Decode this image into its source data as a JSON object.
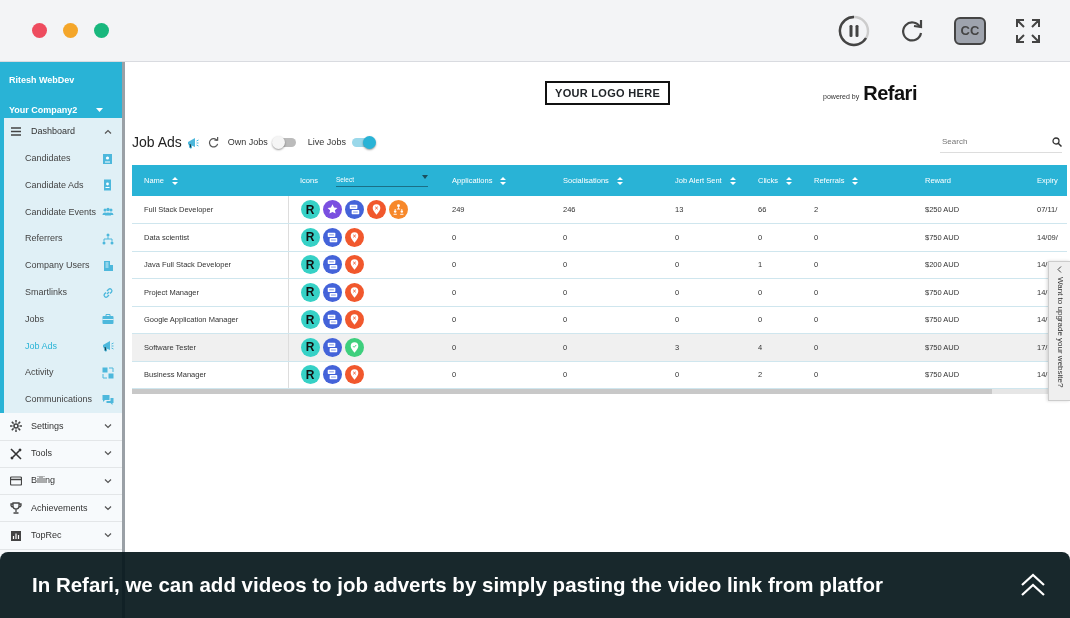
{
  "player": {
    "controls": [
      {
        "kind": "pause"
      },
      {
        "kind": "reload"
      },
      {
        "kind": "cc",
        "label": "CC",
        "on": true
      },
      {
        "kind": "fullscreen"
      }
    ]
  },
  "sidebar": {
    "user": "Ritesh WebDev",
    "company": "Your Company2",
    "sections": [
      {
        "label": "Dashboard",
        "expanded": true,
        "children": [
          {
            "label": "Candidates",
            "selected": false
          },
          {
            "label": "Candidate Ads",
            "selected": false
          },
          {
            "label": "Candidate Events",
            "selected": false
          },
          {
            "label": "Referrers",
            "selected": false
          },
          {
            "label": "Company Users",
            "selected": false
          },
          {
            "label": "Smartlinks",
            "selected": false
          },
          {
            "label": "Jobs",
            "selected": false
          },
          {
            "label": "Job Ads",
            "selected": true
          },
          {
            "label": "Activity",
            "selected": false
          },
          {
            "label": "Communications",
            "selected": false
          }
        ]
      },
      {
        "label": "Settings",
        "expanded": false
      },
      {
        "label": "Tools",
        "expanded": false
      },
      {
        "label": "Billing",
        "expanded": false
      },
      {
        "label": "Achievements",
        "expanded": false
      },
      {
        "label": "TopRec",
        "expanded": false
      }
    ]
  },
  "header": {
    "logo": "YOUR LOGO HERE",
    "powered_by": "powered by",
    "brand": "Refari"
  },
  "toolbar": {
    "title": "Job Ads",
    "toggles": [
      {
        "label": "Own Jobs",
        "on": false
      },
      {
        "label": "Live Jobs",
        "on": true
      }
    ],
    "search": {
      "placeholder": "Search"
    }
  },
  "table": {
    "columns": [
      {
        "label": "Name",
        "sortable": true
      },
      {
        "label": "Icons",
        "sortable": false,
        "filter": "Select"
      },
      {
        "label": "Applications",
        "sortable": true
      },
      {
        "label": "Socialisations",
        "sortable": true
      },
      {
        "label": "Job Alert Sent",
        "sortable": true
      },
      {
        "label": "Clicks",
        "sortable": true
      },
      {
        "label": "Referrals",
        "sortable": true
      },
      {
        "label": "Reward",
        "sortable": false
      },
      {
        "label": "Expiry"
      }
    ],
    "rows": [
      {
        "cells": [
          "Full Stack Developer",
          {
            "badges": [
              {
                "kind": "refari",
                "label": "R"
              },
              {
                "kind": "star"
              },
              {
                "kind": "chat"
              },
              {
                "kind": "pin-x"
              },
              {
                "kind": "org"
              }
            ]
          },
          "249",
          "246",
          "13",
          "66",
          "2",
          "$250 AUD",
          "07/11/"
        ],
        "highlighted": false
      },
      {
        "cells": [
          "Data scientist",
          {
            "badges": [
              {
                "kind": "refari",
                "label": "R"
              },
              {
                "kind": "chat"
              },
              {
                "kind": "pin-x"
              }
            ]
          },
          "0",
          "0",
          "0",
          "0",
          "0",
          "$750 AUD",
          "14/09/"
        ],
        "highlighted": false
      },
      {
        "cells": [
          "Java Full Stack Developer",
          {
            "badges": [
              {
                "kind": "refari",
                "label": "R"
              },
              {
                "kind": "chat"
              },
              {
                "kind": "pin-x"
              }
            ]
          },
          "0",
          "0",
          "0",
          "1",
          "0",
          "$200 AUD",
          "14/"
        ],
        "highlighted": false
      },
      {
        "cells": [
          "Project Manager",
          {
            "badges": [
              {
                "kind": "refari",
                "label": "R"
              },
              {
                "kind": "chat"
              },
              {
                "kind": "pin-x"
              }
            ]
          },
          "0",
          "0",
          "0",
          "0",
          "0",
          "$750 AUD",
          "14/"
        ],
        "highlighted": false
      },
      {
        "cells": [
          "Google Application Manager",
          {
            "badges": [
              {
                "kind": "refari",
                "label": "R"
              },
              {
                "kind": "chat"
              },
              {
                "kind": "pin-x"
              }
            ]
          },
          "0",
          "0",
          "0",
          "0",
          "0",
          "$750 AUD",
          "14/"
        ],
        "highlighted": false
      },
      {
        "cells": [
          "Software Tester",
          {
            "badges": [
              {
                "kind": "refari",
                "label": "R"
              },
              {
                "kind": "chat"
              },
              {
                "kind": "pin-check"
              }
            ]
          },
          "0",
          "0",
          "3",
          "4",
          "0",
          "$750 AUD",
          "17/"
        ],
        "highlighted": true
      },
      {
        "cells": [
          "Business Manager",
          {
            "badges": [
              {
                "kind": "refari",
                "label": "R"
              },
              {
                "kind": "chat"
              },
              {
                "kind": "pin-x"
              }
            ]
          },
          "0",
          "0",
          "0",
          "2",
          "0",
          "$750 AUD",
          "14/"
        ],
        "highlighted": false
      }
    ]
  },
  "upgrade_tab": {
    "label": "Want to upgrade your website?"
  },
  "caption": {
    "text": "In Refari, we can add videos to job adverts by simply pasting the video link from platfor"
  }
}
